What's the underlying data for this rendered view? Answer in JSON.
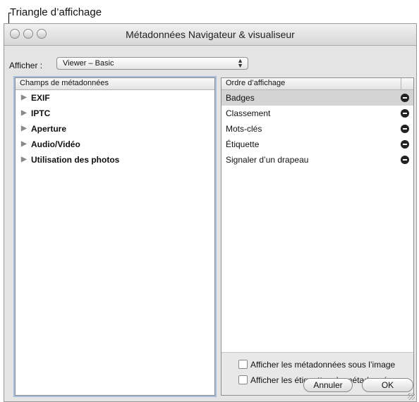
{
  "callout": {
    "label": "Triangle d’affichage"
  },
  "window": {
    "title": "Métadonnées Navigateur & visualiseur"
  },
  "afficher": {
    "label": "Afficher :",
    "value": "Viewer – Basic"
  },
  "left_panel": {
    "header": "Champs de métadonnées",
    "items": [
      {
        "label": "EXIF"
      },
      {
        "label": "IPTC"
      },
      {
        "label": "Aperture"
      },
      {
        "label": "Audio/Vidéo"
      },
      {
        "label": "Utilisation des photos"
      }
    ]
  },
  "right_panel": {
    "header": "Ordre d’affichage",
    "items": [
      {
        "label": "Badges",
        "selected": true
      },
      {
        "label": "Classement"
      },
      {
        "label": "Mots-clés"
      },
      {
        "label": "Étiquette"
      },
      {
        "label": "Signaler d’un drapeau"
      }
    ],
    "options": {
      "show_below_image": "Afficher les métadonnées sous l’image",
      "show_labels": "Afficher les étiquettes de métadonnées"
    }
  },
  "buttons": {
    "cancel": "Annuler",
    "ok": "OK"
  },
  "icons": {
    "disclosure": "disclosure-triangle-icon",
    "remove": "remove-icon"
  }
}
